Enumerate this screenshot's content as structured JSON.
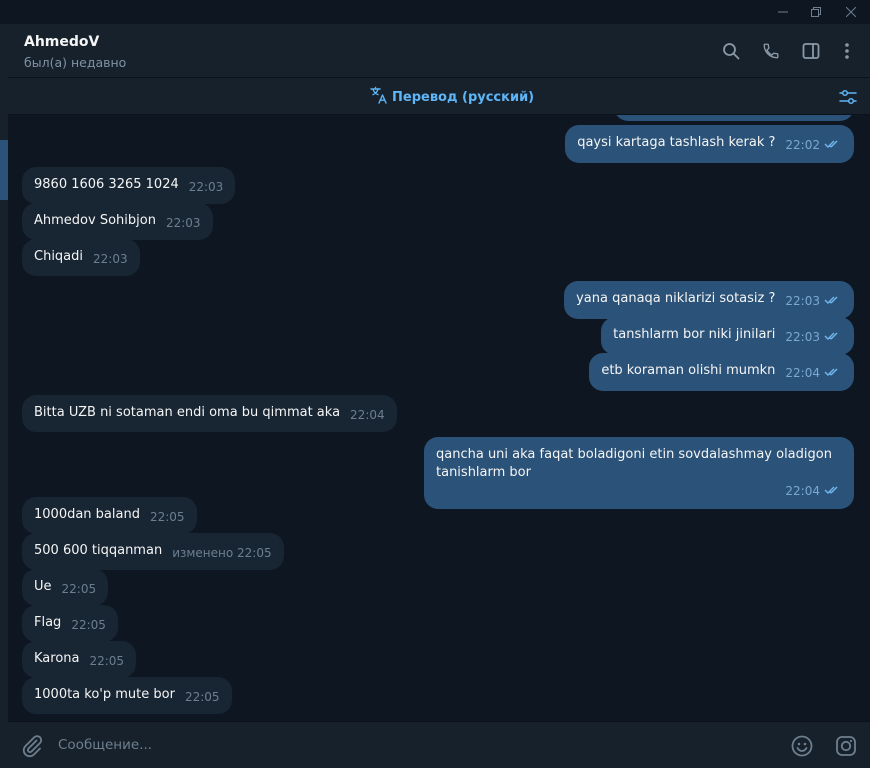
{
  "header": {
    "name": "AhmedoV",
    "status": "был(а) недавно"
  },
  "translate_bar": {
    "label": "Перевод (русский)"
  },
  "messages": [
    {
      "dir": "out",
      "text": "qaysi kartaga tashlash kerak ?",
      "time": "22:02",
      "read": true
    },
    {
      "dir": "in",
      "text": "9860 1606 3265 1024",
      "time": "22:03"
    },
    {
      "dir": "in",
      "text": "Ahmedov Sohibjon",
      "time": "22:03"
    },
    {
      "dir": "in",
      "text": "Chiqadi",
      "time": "22:03"
    },
    {
      "dir": "out",
      "text": "yana qanaqa niklarizi sotasiz ?",
      "time": "22:03",
      "read": true
    },
    {
      "dir": "out",
      "text": "tanshlarm bor niki jinilari",
      "time": "22:03",
      "read": true
    },
    {
      "dir": "out",
      "text": "etb koraman olishi mumkn",
      "time": "22:04",
      "read": true
    },
    {
      "dir": "in",
      "text": "Bitta UZB ni sotaman endi oma bu qimmat aka",
      "time": "22:04"
    },
    {
      "dir": "out",
      "text": "qancha uni aka faqat boladigoni etin sovdalashmay oladigon tanishlarm bor",
      "time": "22:04",
      "read": true
    },
    {
      "dir": "in",
      "text": "1000dan baland",
      "time": "22:05"
    },
    {
      "dir": "in",
      "text": "500 600 tiqqanman",
      "time": "изменено 22:05"
    },
    {
      "dir": "in",
      "text": "Ue",
      "time": "22:05"
    },
    {
      "dir": "in",
      "text": "Flag",
      "time": "22:05"
    },
    {
      "dir": "in",
      "text": "Karona",
      "time": "22:05"
    },
    {
      "dir": "in",
      "text": "1000ta ko'p mute bor",
      "time": "22:05"
    }
  ],
  "composer": {
    "placeholder": "Сообщение..."
  },
  "icons": {
    "search": "search-icon",
    "call": "phone-icon",
    "side_panel": "sidebar-toggle-icon",
    "more": "more-vertical-icon",
    "translate": "translate-icon",
    "filter": "settings-sliders-icon",
    "attach": "paperclip-icon",
    "emoji": "emoji-icon",
    "sticker": "sticker-icon"
  },
  "colors": {
    "background": "#0e1621",
    "panel": "#17212b",
    "incoming_bubble": "#182533",
    "outgoing_bubble": "#2b5278",
    "accent": "#5eb5f7"
  }
}
